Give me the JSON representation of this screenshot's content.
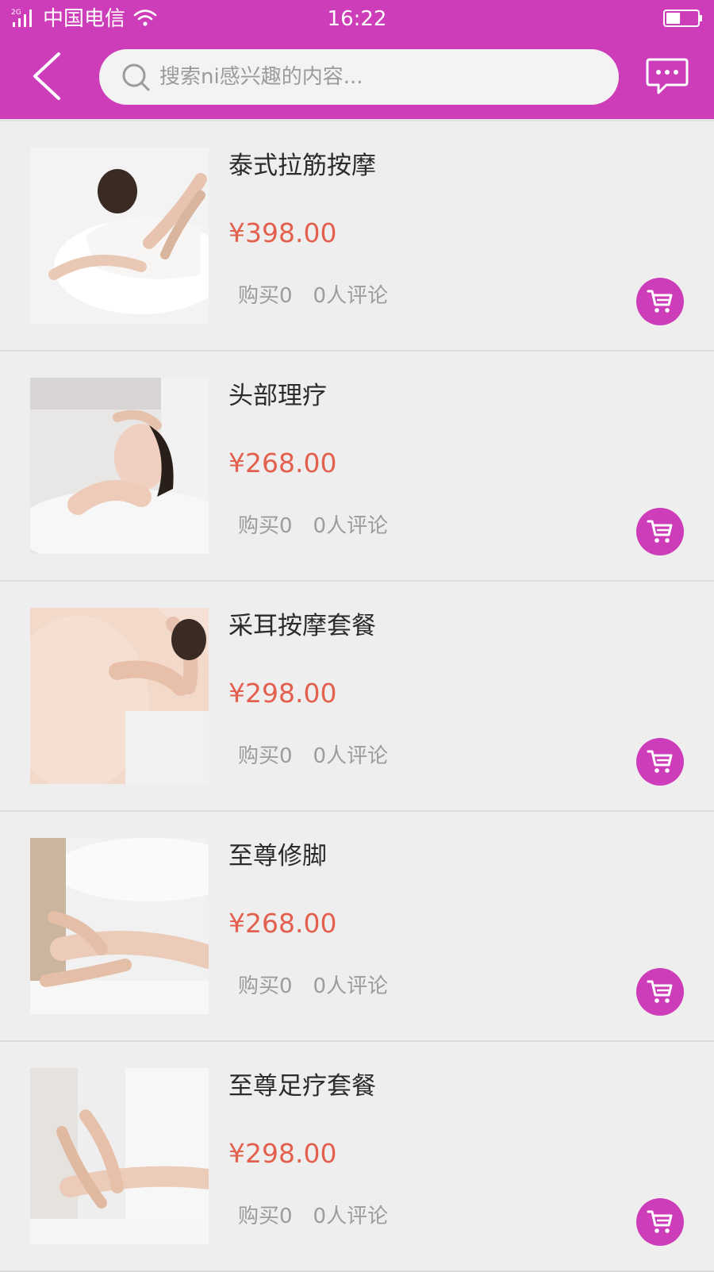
{
  "status_bar": {
    "network": "2G",
    "carrier": "中国电信",
    "time": "16:22",
    "battery_level": 0.45
  },
  "header": {
    "search_placeholder": "搜索ni感兴趣的内容..."
  },
  "colors": {
    "brand": "#cd3db9",
    "price": "#e2604d",
    "background": "#efeeef"
  },
  "products": [
    {
      "title": "泰式拉筋按摩",
      "price": "¥398.00",
      "purchases": "购买0",
      "reviews": "0人评论",
      "image": "back-massage-photo"
    },
    {
      "title": "头部理疗",
      "price": "¥268.00",
      "purchases": "购买0",
      "reviews": "0人评论",
      "image": "head-therapy-photo"
    },
    {
      "title": "采耳按摩套餐",
      "price": "¥298.00",
      "purchases": "购买0",
      "reviews": "0人评论",
      "image": "neck-ear-massage-photo"
    },
    {
      "title": "至尊修脚",
      "price": "¥268.00",
      "purchases": "购买0",
      "reviews": "0人评论",
      "image": "foot-care-photo"
    },
    {
      "title": "至尊足疗套餐",
      "price": "¥298.00",
      "purchases": "购买0",
      "reviews": "0人评论",
      "image": "foot-massage-photo"
    }
  ]
}
